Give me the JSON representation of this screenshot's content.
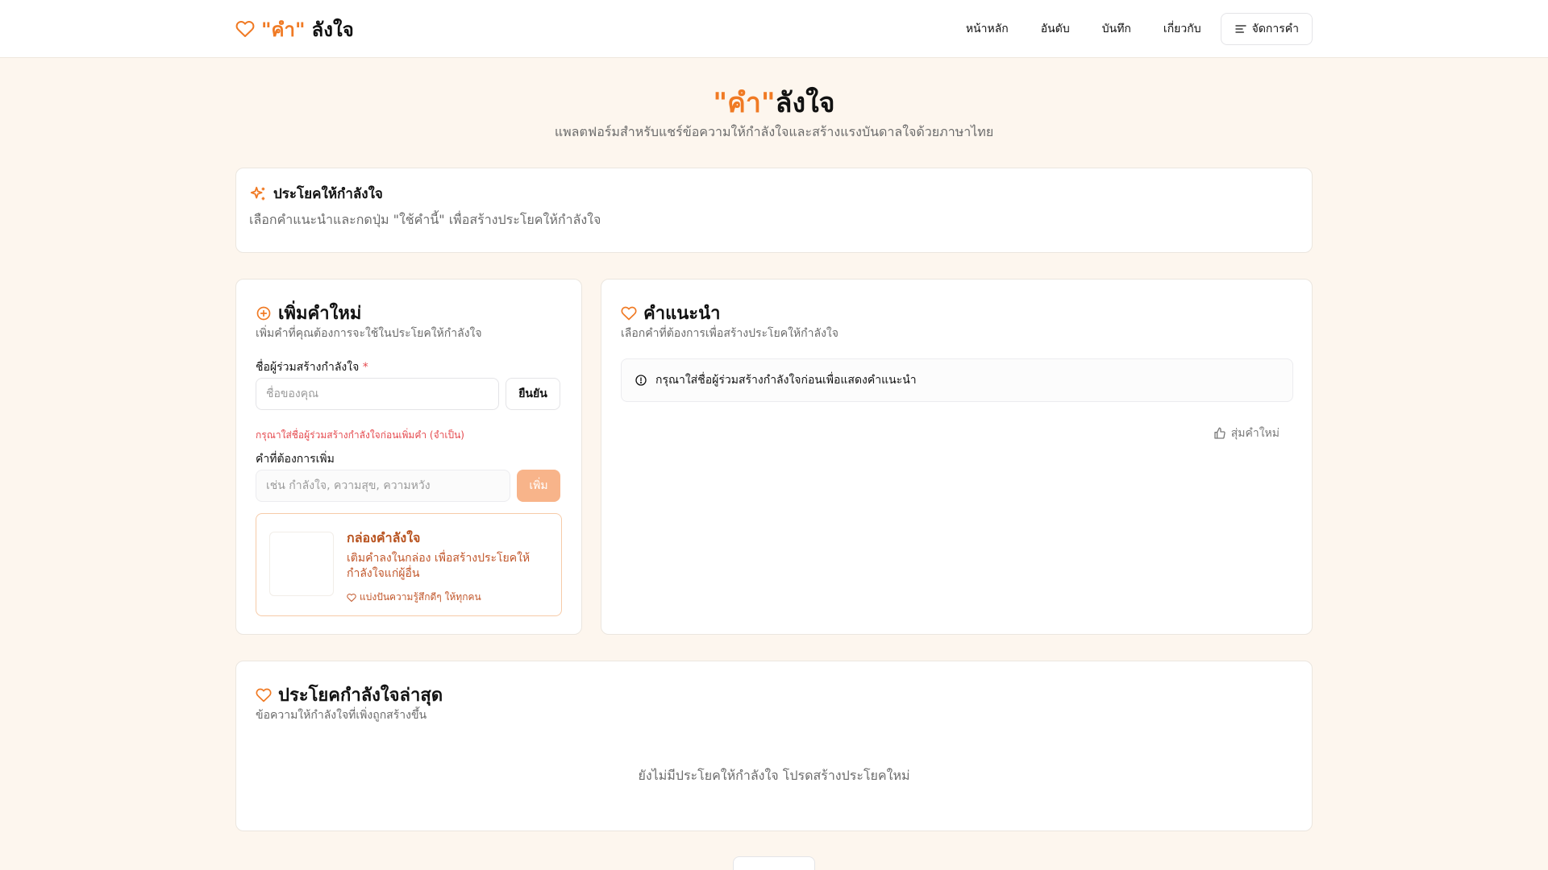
{
  "header": {
    "brand_quote": "\"คำ\"",
    "brand_rest": "ลังใจ",
    "nav": [
      "หน้าหลัก",
      "อันดับ",
      "บันทึก",
      "เกี่ยวกับ"
    ],
    "manage_label": "จัดการคำ"
  },
  "hero": {
    "title_quote": "\"คำ\"",
    "title_rest": "ลังใจ",
    "subtitle": "แพลตฟอร์มสำหรับแชร์ข้อความให้กำลังใจและสร้างแรงบันดาลใจด้วยภาษาไทย"
  },
  "sentence_card": {
    "title": "ประโยคให้กำลังใจ",
    "description": "เลือกคำแนะนำและกดปุ่ม \"ใช้คำนี้\" เพื่อสร้างประโยคให้กำลังใจ"
  },
  "add_word": {
    "title": "เพิ่มคำใหม่",
    "description": "เพิ่มคำที่คุณต้องการจะใช้ในประโยคให้กำลังใจ",
    "name_label": "ชื่อผู้ร่วมสร้างกำลังใจ",
    "required_mark": "*",
    "name_placeholder": "ชื่อของคุณ",
    "confirm_label": "ยืนยัน",
    "name_error": "กรุณาใส่ชื่อผู้ร่วมสร้างกำลังใจก่อนเพิ่มคำ (จำเป็น)",
    "word_label": "คำที่ต้องการเพิ่ม",
    "word_placeholder": "เช่น กำลังใจ, ความสุข, ความหวัง",
    "add_label": "เพิ่ม",
    "promo": {
      "title": "กล่องคำลังใจ",
      "description": "เติมคำลงในกล่อง เพื่อสร้างประโยคให้กำลังใจแก่ผู้อื่น",
      "footer": "แบ่งปันความรู้สึกดีๆ ให้ทุกคน"
    }
  },
  "suggestions": {
    "title": "คำแนะนำ",
    "description": "เลือกคำที่ต้องการเพื่อสร้างประโยคให้กำลังใจ",
    "notice": "กรุณาใส่ชื่อผู้ร่วมสร้างกำลังใจก่อนเพื่อแสดงคำแนะนำ",
    "shuffle_label": "สุ่มคำใหม่"
  },
  "latest": {
    "title": "ประโยคกำลังใจล่าสุด",
    "description": "ข้อความให้กำลังใจที่เพิ่งถูกสร้างขึ้น",
    "empty": "ยังไม่มีประโยคให้กำลังใจ โปรดสร้างประโยคใหม่"
  },
  "colors": {
    "accent": "#f07a24",
    "page_bg": "#fdf6ee",
    "error": "#e5484d"
  },
  "icons": {
    "brand": "heart-icon",
    "manage": "list-icon",
    "sentence": "sparkles-icon",
    "add": "plus-circle-icon",
    "suggest": "heart-icon",
    "notice": "alert-circle-icon",
    "shuffle": "thumbs-up-icon",
    "latest": "heart-icon"
  }
}
